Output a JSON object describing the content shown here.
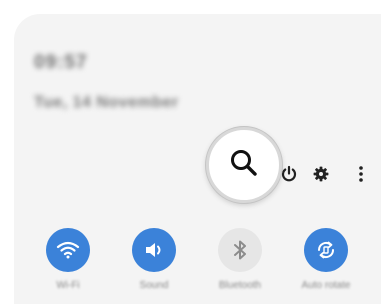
{
  "header": {
    "time": "09:57",
    "date": "Tue, 14 November"
  },
  "actions": [
    {
      "icon": "power-icon"
    },
    {
      "icon": "gear-icon"
    },
    {
      "icon": "more-icon"
    }
  ],
  "quick_settings": [
    {
      "label": "Wi-Fi",
      "icon": "wifi-icon",
      "active": true
    },
    {
      "label": "Sound",
      "icon": "sound-icon",
      "active": true
    },
    {
      "label": "Bluetooth",
      "icon": "bluetooth-icon",
      "active": false
    },
    {
      "label": "Auto rotate",
      "icon": "auto-rotate-icon",
      "active": true
    }
  ],
  "search": {
    "icon": "search-icon"
  },
  "colors": {
    "accent": "#3b82d9",
    "panel_bg": "#f4f4f4",
    "icon_dark": "#222222"
  }
}
